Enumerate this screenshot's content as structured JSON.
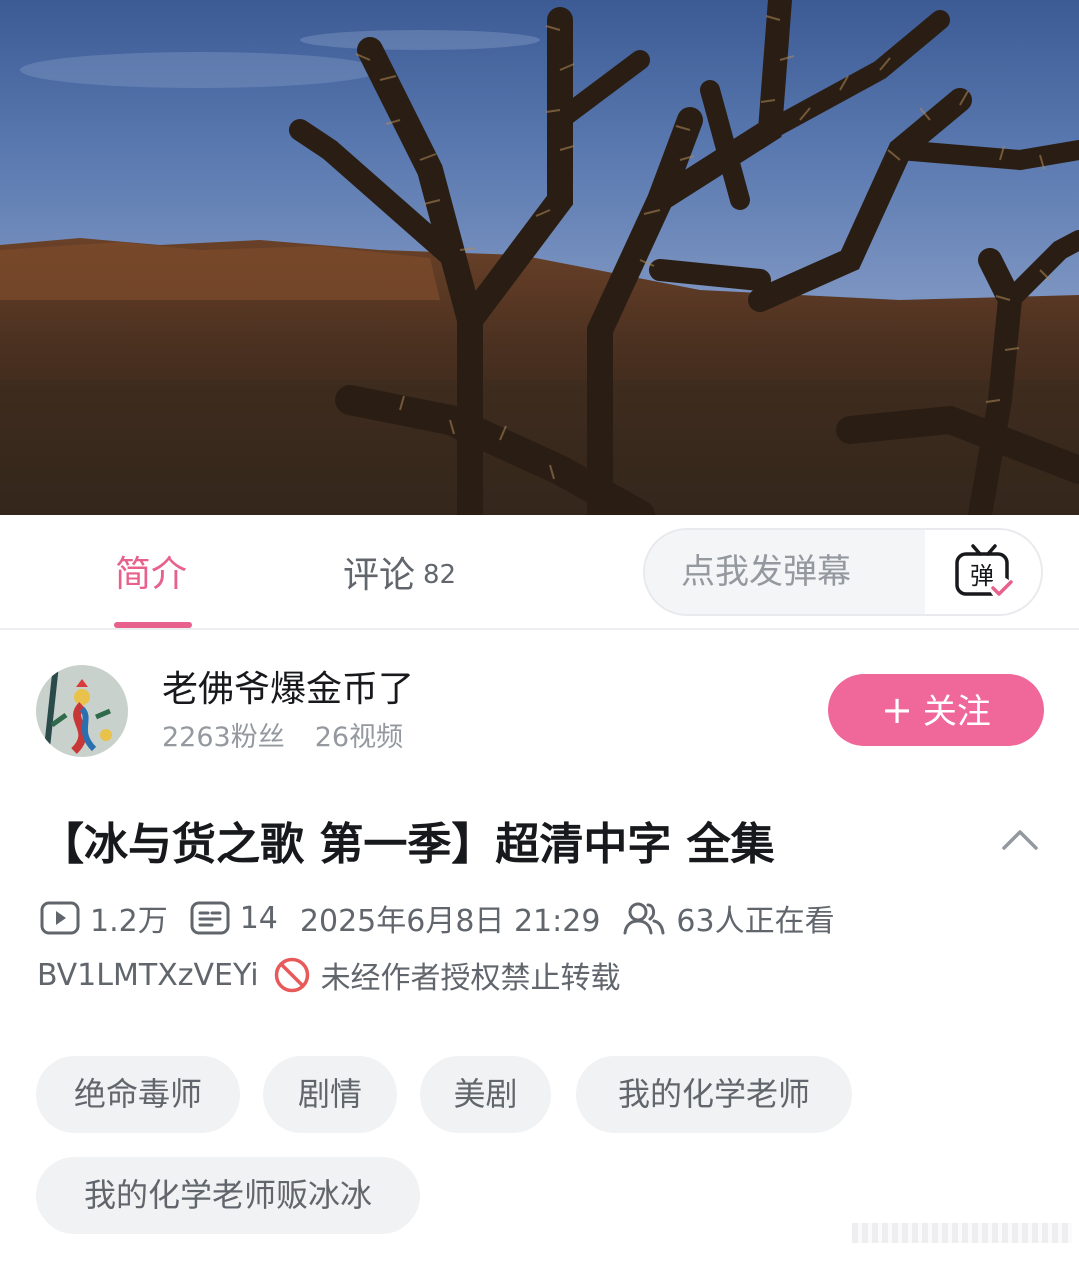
{
  "video": {
    "scene_icon": "desert-cactus-frame"
  },
  "tabs": {
    "intro_label": "简介",
    "comments_label": "评论",
    "comments_count": "82",
    "danmaku_placeholder": "点我发弹幕",
    "danmaku_icon_text": "弹"
  },
  "uploader": {
    "name": "老佛爷爆金币了",
    "fans": "2263粉丝",
    "videos": "26视频",
    "follow_label": "关注",
    "follow_icon": "+"
  },
  "video_info": {
    "title": "【冰与货之歌 第一季】超清中字 全集",
    "plays": "1.2万",
    "danmaku_count": "14",
    "date": "2025年6月8日 21:29",
    "watching": "63人正在看",
    "bvid": "BV1LMTXzVEYi",
    "copyright_notice": "未经作者授权禁止转载"
  },
  "tags": [
    "绝命毒师",
    "剧情",
    "美剧",
    "我的化学老师",
    "我的化学老师贩冰冰"
  ],
  "colors": {
    "accent": "#e8618c",
    "follow_bg": "#f0689a",
    "forbid": "#e85a5a"
  }
}
